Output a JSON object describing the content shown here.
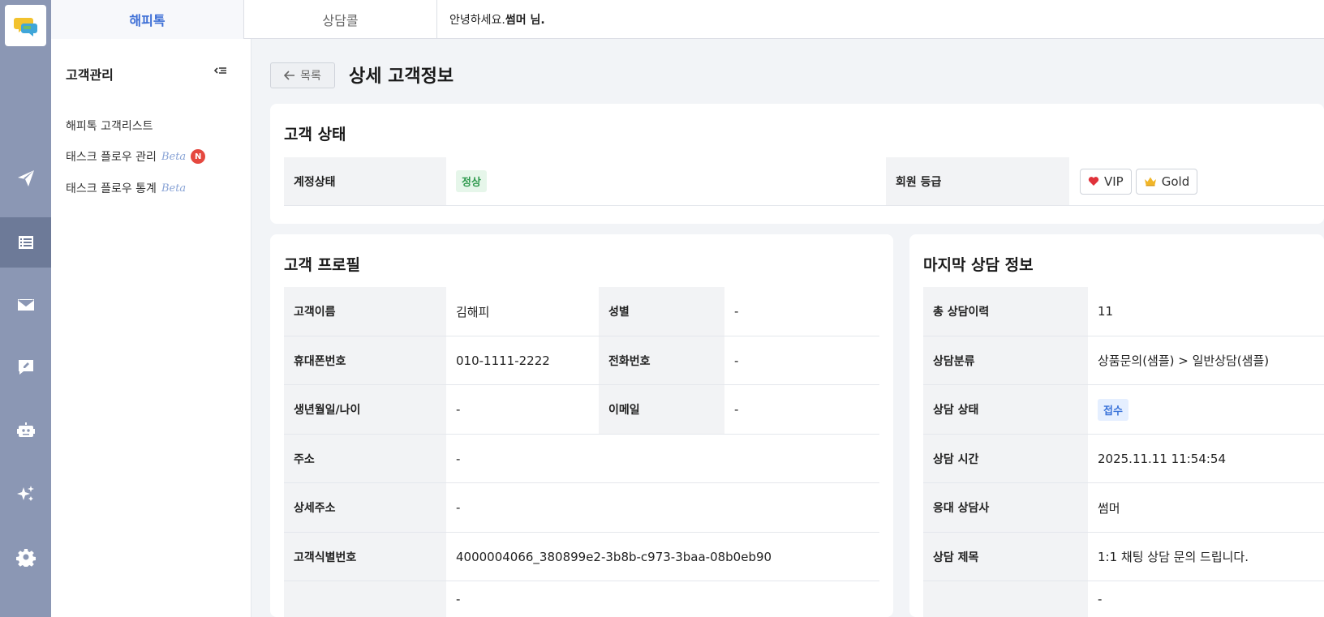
{
  "topbar": {
    "tabs": [
      {
        "label": "해피톡"
      },
      {
        "label": "상담콜"
      }
    ],
    "greeting_prefix": "안녕하세요.",
    "greeting_name": "썸머 님."
  },
  "sidemenu": {
    "title": "고객관리",
    "items": [
      {
        "label": "해피톡 고객리스트"
      },
      {
        "label": "태스크 플로우 관리",
        "beta": "Beta",
        "badge": "N"
      },
      {
        "label": "태스크 플로우 통계",
        "beta": "Beta"
      }
    ]
  },
  "header": {
    "back_label": "목록",
    "title": "상세 고객정보"
  },
  "status_card": {
    "title": "고객 상태",
    "account_label": "계정상태",
    "account_value": "정상",
    "grade_label": "회원 등급",
    "grades": [
      {
        "label": "VIP",
        "icon": "heart-icon"
      },
      {
        "label": "Gold",
        "icon": "crown-icon"
      }
    ]
  },
  "profile_card": {
    "title": "고객 프로필",
    "rows": [
      {
        "l1": "고객이름",
        "v1": "김해피",
        "l2": "성별",
        "v2": "-"
      },
      {
        "l1": "휴대폰번호",
        "v1": "010-1111-2222",
        "l2": "전화번호",
        "v2": "-"
      },
      {
        "l1": "생년월일/나이",
        "v1": "-",
        "l2": "이메일",
        "v2": "-"
      }
    ],
    "wide_rows": [
      {
        "label": "주소",
        "value": "-"
      },
      {
        "label": "상세주소",
        "value": "-"
      },
      {
        "label": "고객식별번호",
        "value": "4000004066_380899e2-3b8b-c973-3baa-08b0eb90"
      },
      {
        "label": "",
        "value": "-"
      }
    ]
  },
  "consult_card": {
    "title": "마지막 상담 정보",
    "rows": [
      {
        "label": "총 상담이력",
        "value": "11"
      },
      {
        "label": "상담분류",
        "value": "상품문의(샘플) > 일반상담(샘플)"
      },
      {
        "label": "상담 상태",
        "value": "접수"
      },
      {
        "label": "상담 시간",
        "value": "2025.11.11 11:54:54"
      },
      {
        "label": "응대 상담사",
        "value": "썸머"
      },
      {
        "label": "상담 제목",
        "value": "1:1 채팅 상담 문의 드립니다."
      },
      {
        "label": "",
        "value": "-"
      }
    ]
  },
  "colors": {
    "rail": "#8b97b4",
    "rail_active": "#6d7a98",
    "accent": "#3e6fd6",
    "status_green": "#2f9a4e",
    "status_blue": "#3a73d9",
    "badge_red": "#e5483f"
  }
}
